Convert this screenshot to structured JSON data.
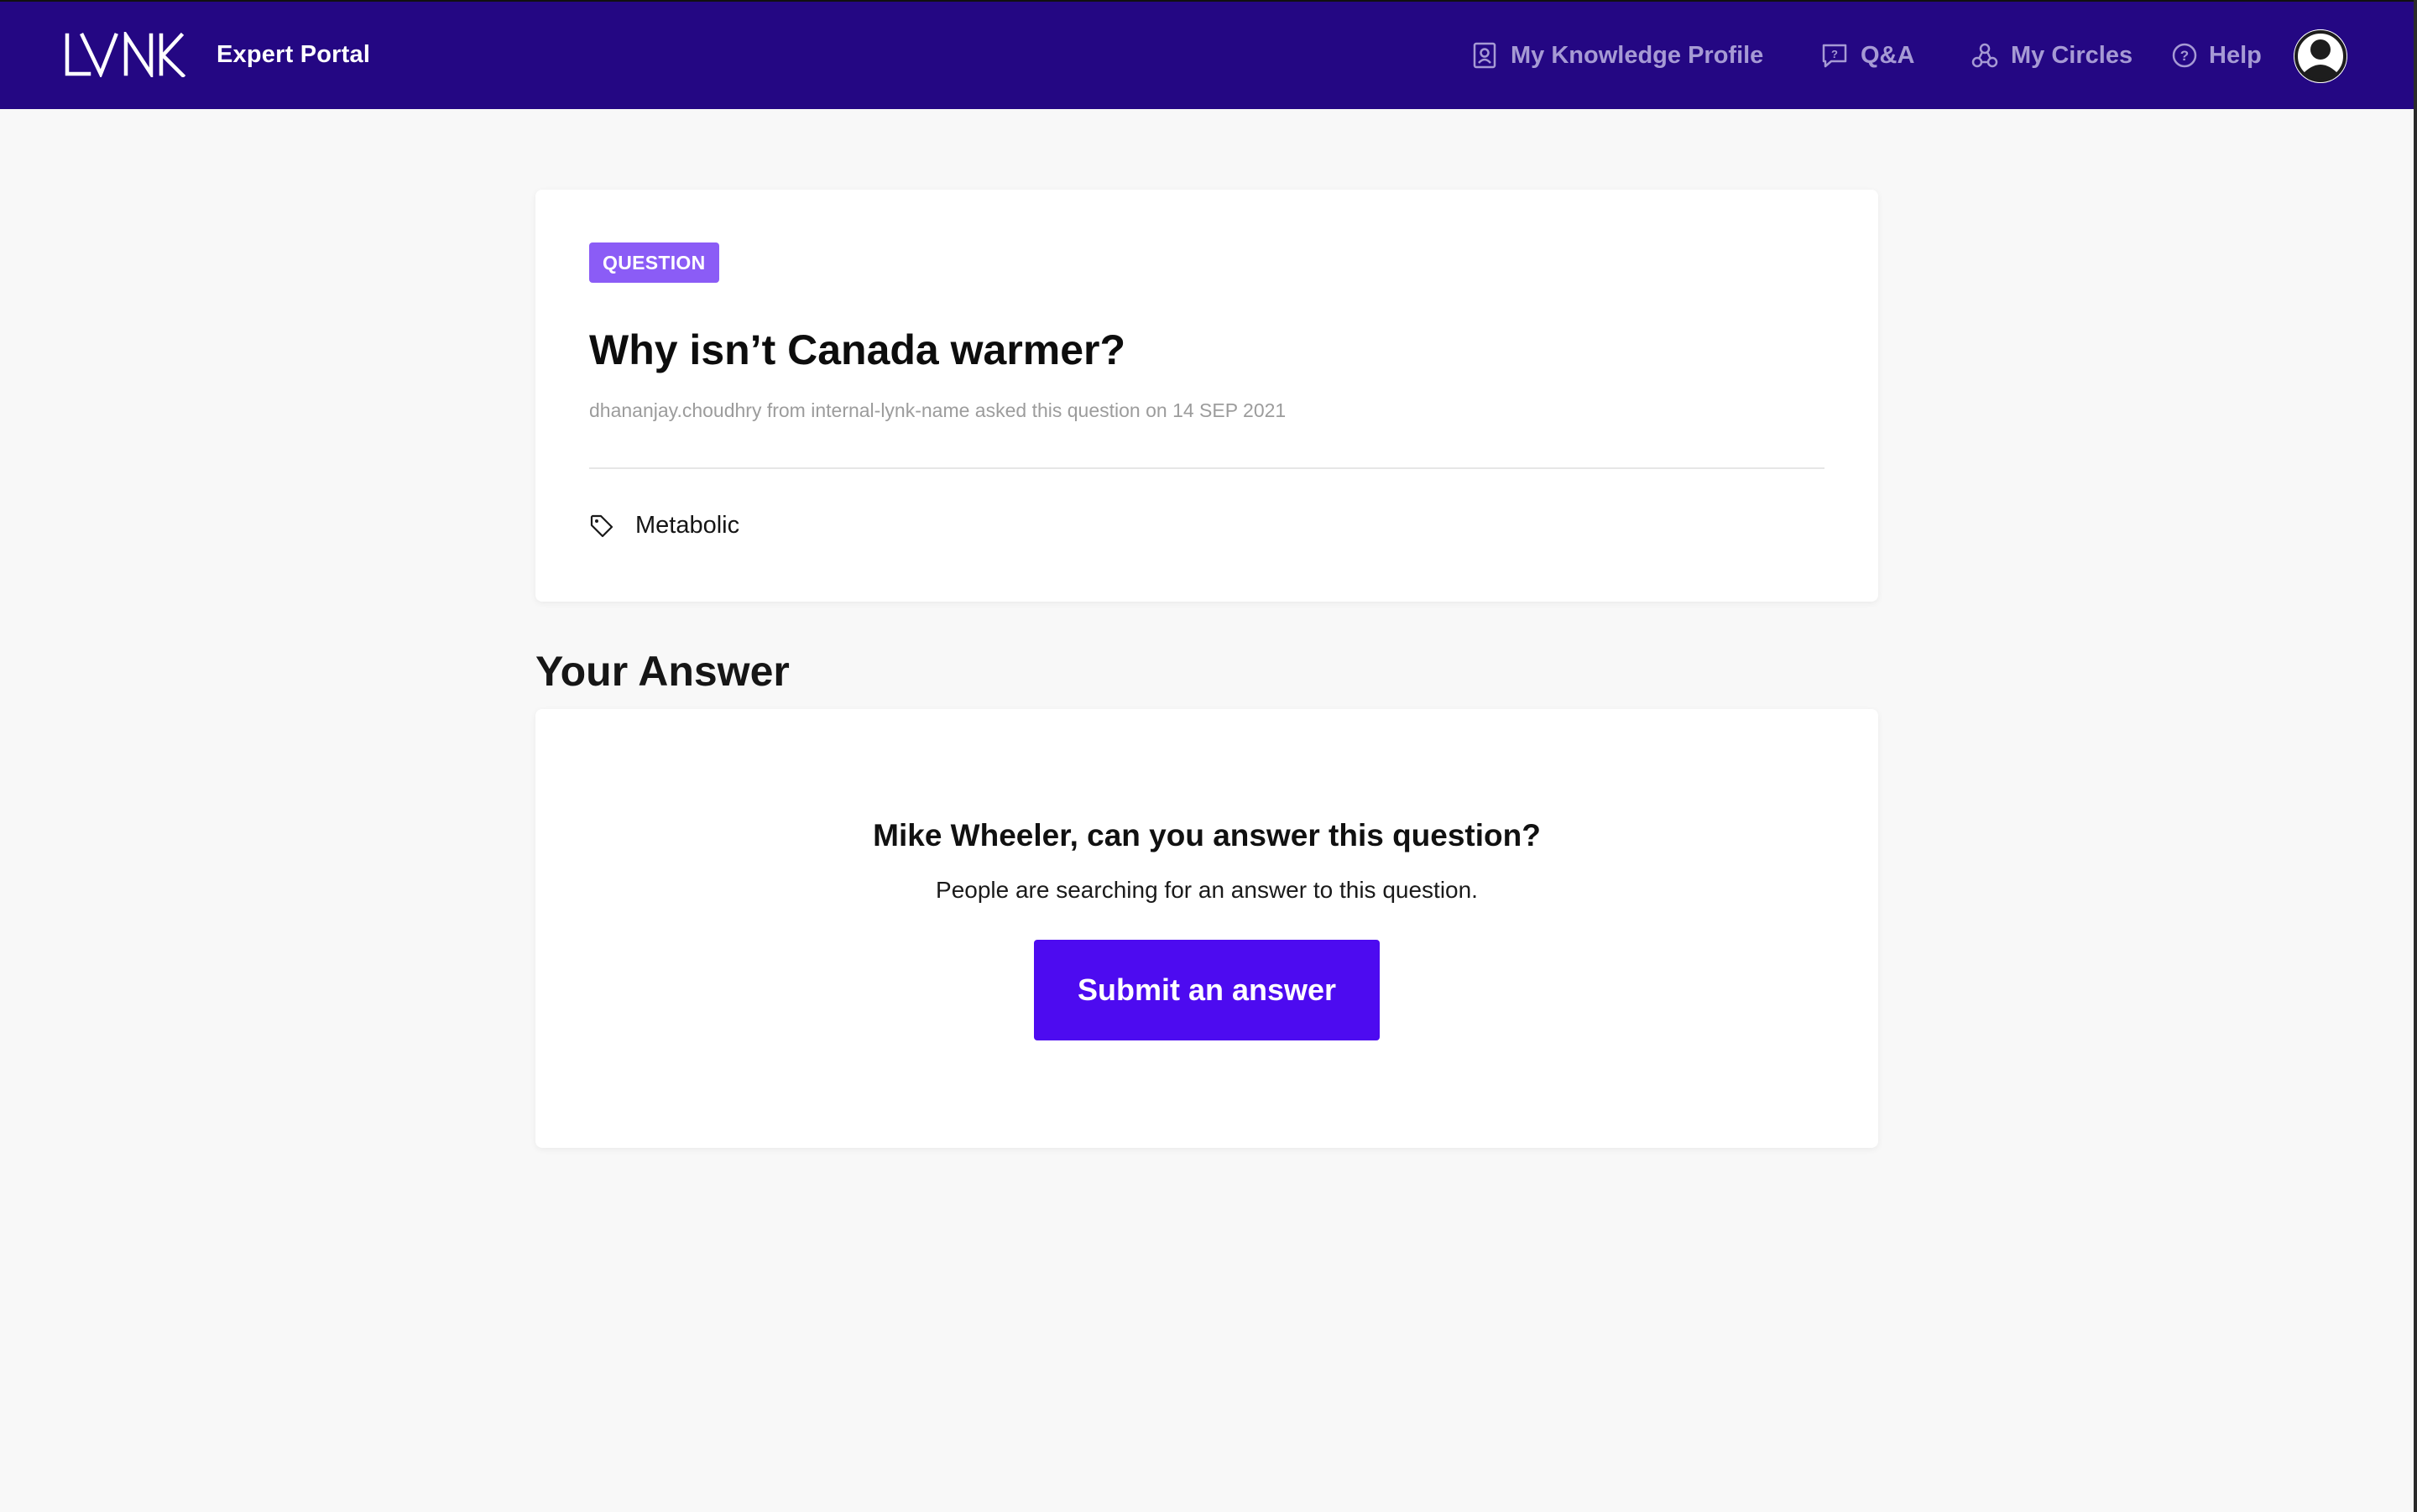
{
  "header": {
    "brand_name": "Expert Portal",
    "logo_text": "LYNK",
    "nav": [
      {
        "label": "My Knowledge Profile",
        "icon": "profile-icon"
      },
      {
        "label": "Q&A",
        "icon": "qa-icon"
      },
      {
        "label": "My Circles",
        "icon": "circles-icon"
      },
      {
        "label": "Help",
        "icon": "help-icon"
      }
    ],
    "avatar_icon": "user-avatar-icon"
  },
  "question": {
    "badge": "QUESTION",
    "title": "Why isn’t Canada warmer?",
    "meta": "dhananjay.choudhry from internal-lynk-name asked this question on 14 SEP 2021",
    "tag_icon": "tag-icon",
    "tag": "Metabolic"
  },
  "answer_section": {
    "heading": "Your Answer",
    "prompt_title": "Mike Wheeler, can you answer this question?",
    "prompt_sub": "People are searching for an answer to this question.",
    "submit_label": "Submit an answer"
  },
  "colors": {
    "header_bg": "#240783",
    "nav_text": "#a69ad4",
    "badge_bg": "#8b5cf6",
    "primary_button": "#4d0bf0",
    "page_bg": "#f8f8f8"
  }
}
